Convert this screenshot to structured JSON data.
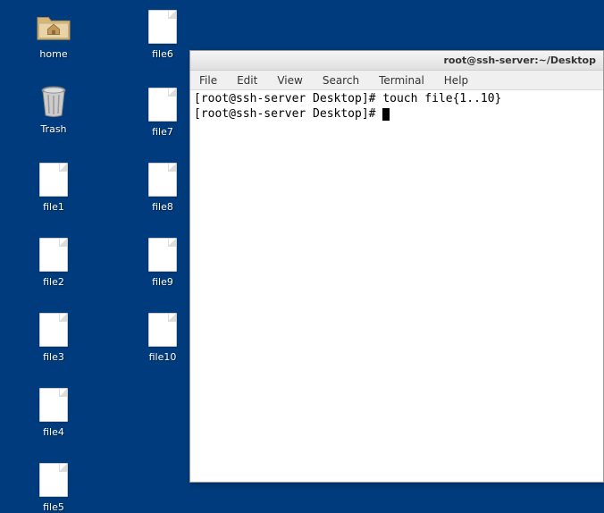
{
  "desktop": {
    "icons": {
      "home": {
        "label": "home"
      },
      "trash": {
        "label": "Trash"
      },
      "file1": {
        "label": "file1"
      },
      "file2": {
        "label": "file2"
      },
      "file3": {
        "label": "file3"
      },
      "file4": {
        "label": "file4"
      },
      "file5": {
        "label": "file5"
      },
      "file6": {
        "label": "file6"
      },
      "file7": {
        "label": "file7"
      },
      "file8": {
        "label": "file8"
      },
      "file9": {
        "label": "file9"
      },
      "file10": {
        "label": "file10"
      }
    }
  },
  "terminal": {
    "title": "root@ssh-server:~/Desktop",
    "menu": {
      "file": "File",
      "edit": "Edit",
      "view": "View",
      "search": "Search",
      "terminal": "Terminal",
      "help": "Help"
    },
    "lines": {
      "line1_prompt": "[root@ssh-server Desktop]# ",
      "line1_cmd": "touch file{1..10}",
      "line2_prompt": "[root@ssh-server Desktop]# "
    }
  }
}
